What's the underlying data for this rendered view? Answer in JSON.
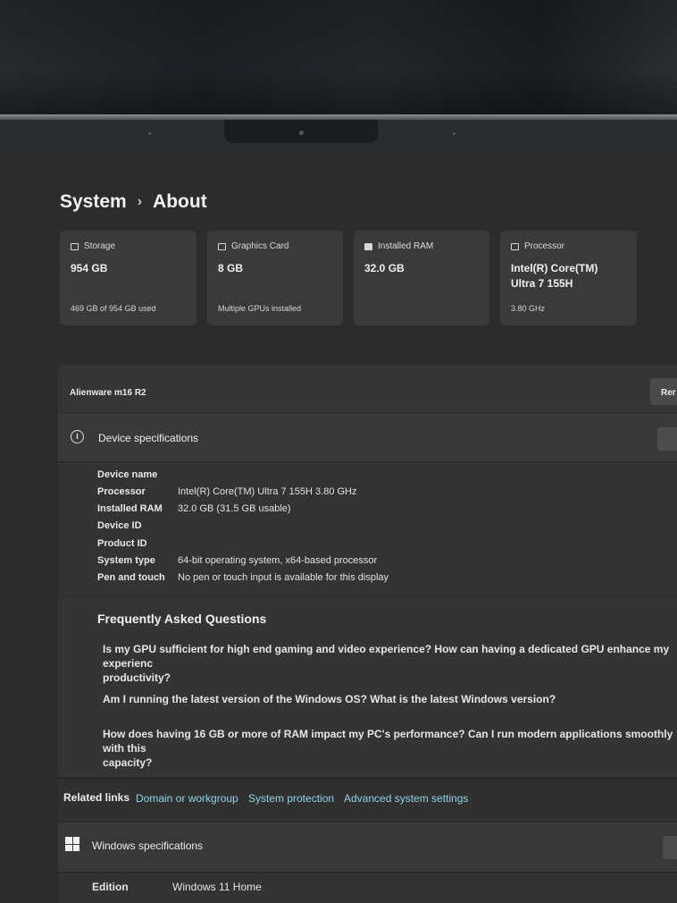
{
  "breadcrumb": {
    "parent": "System",
    "separator": "›",
    "current": "About"
  },
  "cards": [
    {
      "title": "Storage",
      "icon": "storage-icon",
      "value": "954 GB",
      "sub": "469 GB of 954 GB used"
    },
    {
      "title": "Graphics Card",
      "icon": "graphics-card-icon",
      "value": "8 GB",
      "sub": "Multiple GPUs installed"
    },
    {
      "title": "Installed RAM",
      "icon": "ram-icon",
      "value": "32.0 GB",
      "sub": ""
    },
    {
      "title": "Processor",
      "icon": "processor-icon",
      "value": "Intel(R) Core(TM) Ultra 7 155H",
      "sub": "3.80 GHz"
    }
  ],
  "device": {
    "name": "Alienware m16 R2",
    "rename_label": "Rer"
  },
  "device_specs": {
    "title": "Device specifications",
    "rows": [
      {
        "label": "Device name",
        "value": ""
      },
      {
        "label": "Processor",
        "value": "Intel(R) Core(TM) Ultra 7 155H   3.80 GHz"
      },
      {
        "label": "Installed RAM",
        "value": "32.0 GB (31.5 GB usable)"
      },
      {
        "label": "Device ID",
        "value": ""
      },
      {
        "label": "Product ID",
        "value": ""
      },
      {
        "label": "System type",
        "value": "64-bit operating system, x64-based processor"
      },
      {
        "label": "Pen and touch",
        "value": "No pen or touch input is available for this display"
      }
    ]
  },
  "faq": {
    "title": "Frequently Asked Questions",
    "questions": [
      "Is my GPU sufficient for high end gaming and video experience? How can having a dedicated GPU enhance my experienc\nproductivity?",
      "Am I running the latest version of the Windows OS? What is the latest Windows version?",
      "How does having 16 GB or more of RAM impact my PC's performance? Can I run modern applications smoothly with this\ncapacity?"
    ]
  },
  "related_links": {
    "label": "Related links",
    "links": [
      "Domain or workgroup",
      "System protection",
      "Advanced system settings"
    ]
  },
  "windows_specs": {
    "title": "Windows specifications",
    "rows": [
      {
        "label": "Edition",
        "value": "Windows 11 Home"
      }
    ]
  }
}
